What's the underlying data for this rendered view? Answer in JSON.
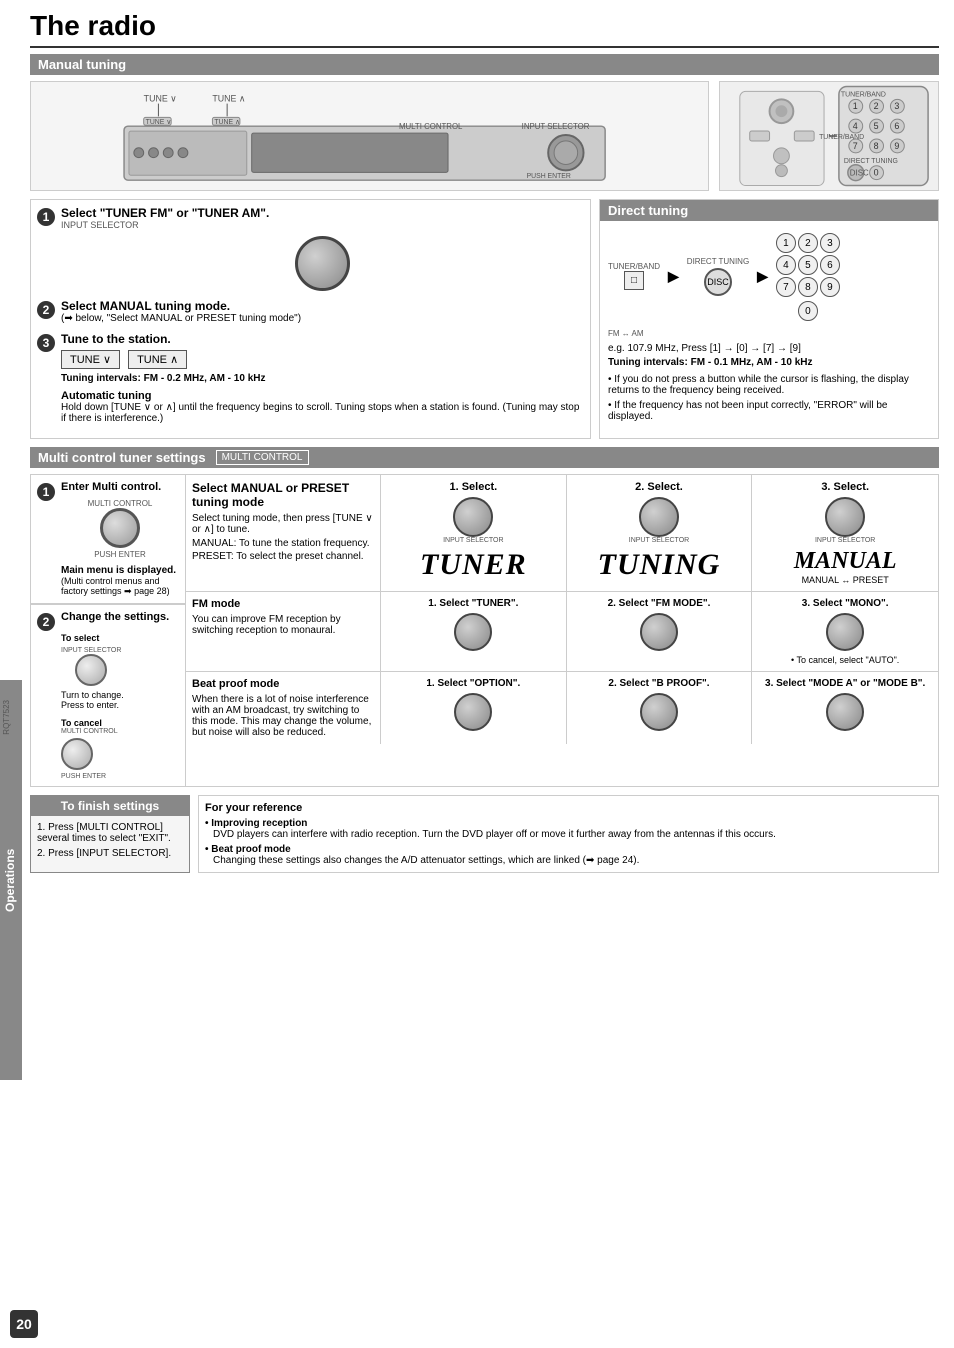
{
  "page": {
    "title": "The radio",
    "number": "20",
    "rqt": "RQT7523"
  },
  "manual_tuning": {
    "section_header": "Manual tuning",
    "steps": [
      {
        "number": "1",
        "title": "Select \"TUNER FM\" or \"TUNER AM\".",
        "sub": "INPUT SELECTOR"
      },
      {
        "number": "2",
        "title": "Select MANUAL tuning mode.",
        "sub": "(➡ below, \"Select MANUAL or PRESET tuning mode\")"
      },
      {
        "number": "3",
        "title": "Tune to the station.",
        "tune_down": "TUNE ∨",
        "tune_up": "TUNE ∧",
        "interval_label": "Tuning intervals:",
        "intervals": "FM - 0.2 MHz, AM - 10 kHz",
        "auto_tuning_title": "Automatic tuning",
        "auto_tuning_text": "Hold down [TUNE ∨ or ∧] until the frequency begins to scroll. Tuning stops when a station is found. (Tuning may stop if there is interference.)"
      }
    ]
  },
  "direct_tuning": {
    "header": "Direct tuning",
    "tuner_band_label": "TUNER/BAND",
    "direct_tuning_label": "DIRECT TUNING",
    "disc_label": "DISC",
    "fm_am_label": "FM ↔ AM",
    "numbers": [
      "1",
      "2",
      "3",
      "4",
      "5",
      "6",
      "7",
      "8",
      "9",
      "0"
    ],
    "example": "e.g. 107.9 MHz, Press [1] → [0] → [7] → [9]",
    "intervals_label": "Tuning intervals:",
    "intervals": "FM - 0.1 MHz, AM - 10 kHz",
    "notes": [
      "If you do not press a button while the cursor is flashing, the display returns to the frequency being received.",
      "If the frequency has not been input correctly, \"ERROR\" will be displayed."
    ]
  },
  "multi_control": {
    "section_header": "Multi control tuner settings",
    "badge": "MULTI CONTROL",
    "steps": [
      {
        "number": "1",
        "title": "Enter Multi control.",
        "sub_label": "MULTI CONTROL",
        "push_enter": "PUSH ENTER",
        "main_menu_label": "Main menu is displayed.",
        "main_menu_sub": "(Multi control menus and factory settings ➡ page 28)"
      },
      {
        "number": "2",
        "title": "Change the settings.",
        "to_select": "To select",
        "turn_to_change": "Turn to change.",
        "press_to_enter": "Press to enter.",
        "to_cancel": "To cancel",
        "multi_control_cancel": "MULTI CONTROL",
        "push_enter_cancel": "PUSH ENTER"
      }
    ],
    "select_cols": [
      {
        "label": "1. Select.",
        "display": "TUNER",
        "type": "large_italic"
      },
      {
        "label": "2. Select.",
        "display": "TUNING",
        "type": "large_italic"
      },
      {
        "label": "3. Select.",
        "display": "MANUAL",
        "sub": "MANUAL ↔ PRESET",
        "type": "manual_italic"
      }
    ],
    "preset_section": {
      "title": "Select MANUAL or PRESET tuning mode",
      "desc1": "Select tuning mode, then press [TUNE ∨ or ∧] to tune.",
      "manual_desc": "MANUAL: To tune the station frequency.",
      "preset_desc": "PRESET: To select the preset channel."
    },
    "fm_mode": {
      "title": "FM mode",
      "desc": "You can improve FM reception by switching reception to monaural.",
      "step1": "1. Select \"TUNER\".",
      "step2": "2. Select \"FM MODE\".",
      "step3": "3. Select \"MONO\".",
      "cancel_note": "• To cancel, select \"AUTO\"."
    },
    "beat_proof": {
      "title": "Beat proof mode",
      "desc": "When there is a lot of noise interference with an AM broadcast, try switching to this mode. This may change the volume, but noise will also be reduced.",
      "step1": "1. Select \"OPTION\".",
      "step2": "2. Select \"B PROOF\".",
      "step3": "3. Select \"MODE A\" or \"MODE B\"."
    }
  },
  "finish_settings": {
    "header": "To finish settings",
    "steps": [
      "1. Press [MULTI CONTROL] several times to select \"EXIT\".",
      "2. Press [INPUT SELECTOR]."
    ]
  },
  "reference": {
    "title": "For your reference",
    "items": [
      {
        "subtitle": "Improving reception",
        "text": "DVD players can interfere with radio reception. Turn the DVD player off or move it further away from the antennas if this occurs."
      },
      {
        "subtitle": "Beat proof mode",
        "text": "Changing these settings also changes the A/D attenuator settings, which are linked (➡ page 24)."
      }
    ]
  },
  "operations_label": "Operations"
}
